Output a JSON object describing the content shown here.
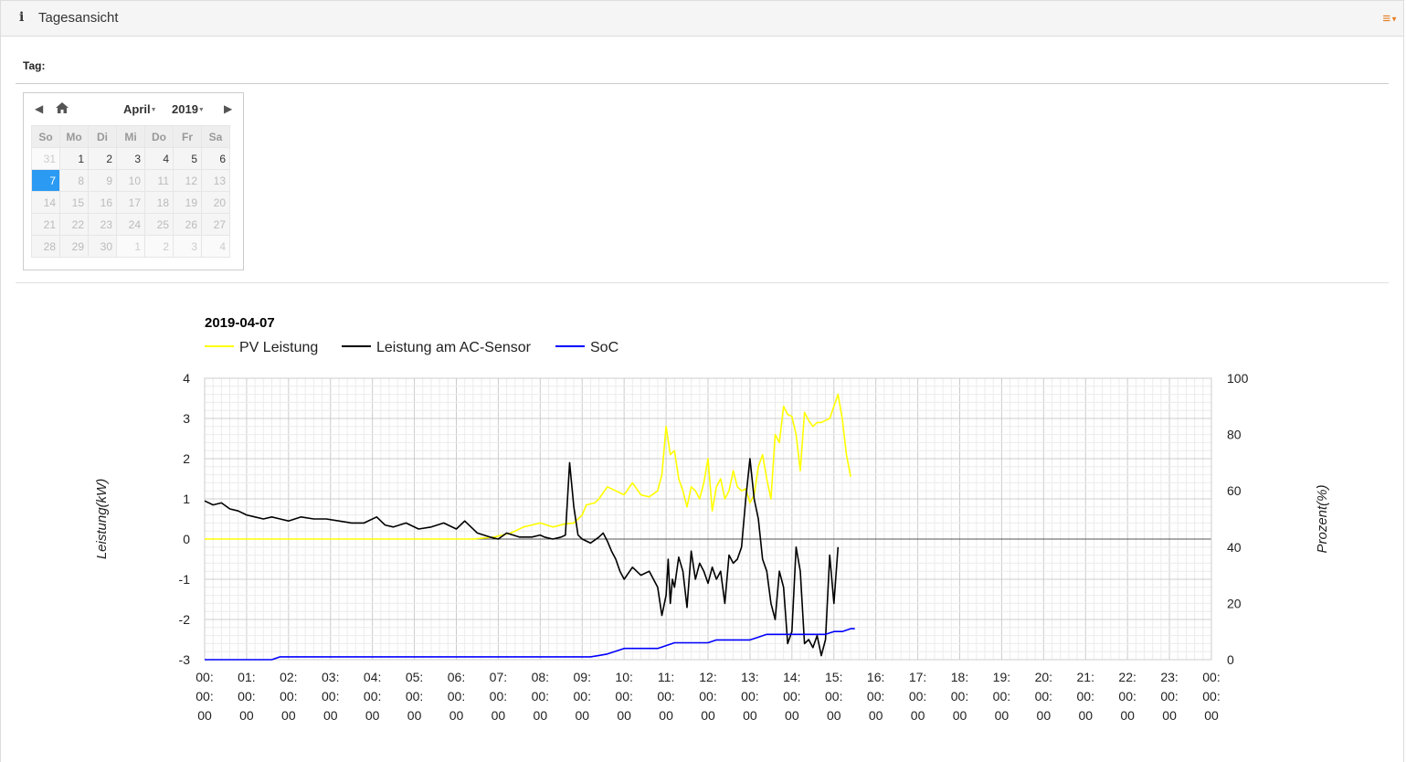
{
  "header": {
    "icon": "info-icon",
    "title": "Tagesansicht",
    "menu_icon": "menu-icon"
  },
  "form": {
    "tag_label": "Tag:"
  },
  "calendar": {
    "month": "April",
    "year": "2019",
    "weekdays": [
      "So",
      "Mo",
      "Di",
      "Mi",
      "Do",
      "Fr",
      "Sa"
    ],
    "weeks": [
      [
        "31",
        "1",
        "2",
        "3",
        "4",
        "5",
        "6"
      ],
      [
        "7",
        "8",
        "9",
        "10",
        "11",
        "12",
        "13"
      ],
      [
        "14",
        "15",
        "16",
        "17",
        "18",
        "19",
        "20"
      ],
      [
        "21",
        "22",
        "23",
        "24",
        "25",
        "26",
        "27"
      ],
      [
        "28",
        "29",
        "30",
        "1",
        "2",
        "3",
        "4"
      ]
    ],
    "selected": "7",
    "selected_color": "#2b9af3"
  },
  "chart_data": {
    "type": "line",
    "title": "2019-04-07",
    "ylabel_left": "Leistung(kW)",
    "ylabel_right": "Prozent(%)",
    "ylim_left": [
      -3,
      4
    ],
    "ylim_right": [
      0,
      100
    ],
    "yticks_left": [
      "4",
      "3",
      "2",
      "1",
      "0",
      "-1",
      "-2",
      "-3"
    ],
    "yticks_right": [
      "100",
      "80",
      "60",
      "40",
      "20",
      "0"
    ],
    "xlim_hours": [
      0,
      24
    ],
    "xticks": [
      "00:00:00",
      "01:00:00",
      "02:00:00",
      "03:00:00",
      "04:00:00",
      "05:00:00",
      "06:00:00",
      "07:00:00",
      "08:00:00",
      "09:00:00",
      "10:00:00",
      "11:00:00",
      "12:00:00",
      "13:00:00",
      "14:00:00",
      "15:00:00",
      "16:00:00",
      "17:00:00",
      "18:00:00",
      "19:00:00",
      "20:00:00",
      "21:00:00",
      "22:00:00",
      "23:00:00",
      "00:00:00"
    ],
    "legend_position": "top-left",
    "grid": true,
    "series": [
      {
        "name": "PV Leistung",
        "color": "#ffff00",
        "axis": "left",
        "x": [
          0,
          6.4,
          6.9,
          7.3,
          7.6,
          8.0,
          8.3,
          8.6,
          8.8,
          9.0,
          9.1,
          9.3,
          9.4,
          9.6,
          9.8,
          10.0,
          10.2,
          10.4,
          10.6,
          10.8,
          10.9,
          11.0,
          11.1,
          11.2,
          11.3,
          11.4,
          11.5,
          11.6,
          11.7,
          11.8,
          11.9,
          12.0,
          12.1,
          12.2,
          12.3,
          12.4,
          12.5,
          12.6,
          12.7,
          12.8,
          12.9,
          13.0,
          13.1,
          13.2,
          13.3,
          13.4,
          13.5,
          13.6,
          13.7,
          13.8,
          13.9,
          14.0,
          14.1,
          14.2,
          14.3,
          14.4,
          14.5,
          14.6,
          14.7,
          14.8,
          14.9,
          15.0,
          15.1,
          15.2,
          15.3,
          15.4,
          15.5
        ],
        "y": [
          0,
          0,
          0.05,
          0.15,
          0.3,
          0.4,
          0.3,
          0.38,
          0.4,
          0.6,
          0.85,
          0.9,
          1.0,
          1.3,
          1.2,
          1.1,
          1.4,
          1.1,
          1.05,
          1.2,
          1.6,
          2.8,
          2.1,
          2.2,
          1.5,
          1.2,
          0.8,
          1.3,
          1.2,
          1.0,
          1.4,
          2.0,
          0.7,
          1.3,
          1.5,
          1.0,
          1.2,
          1.7,
          1.3,
          1.2,
          1.25,
          0.9,
          1.1,
          1.8,
          2.1,
          1.5,
          1.0,
          2.6,
          2.4,
          3.3,
          3.1,
          3.05,
          2.6,
          1.7,
          3.15,
          2.95,
          2.8,
          2.9,
          2.9,
          2.95,
          3.0,
          3.3,
          3.6,
          3.0,
          2.1,
          1.55,
          null
        ]
      },
      {
        "name": "Leistung am AC-Sensor",
        "color": "#000000",
        "axis": "left",
        "x": [
          0,
          0.2,
          0.4,
          0.6,
          0.8,
          1.0,
          1.2,
          1.4,
          1.6,
          1.8,
          2.0,
          2.3,
          2.6,
          2.9,
          3.2,
          3.5,
          3.8,
          4.1,
          4.3,
          4.5,
          4.8,
          5.1,
          5.4,
          5.7,
          6.0,
          6.2,
          6.5,
          6.8,
          7.0,
          7.2,
          7.5,
          7.8,
          8.0,
          8.1,
          8.3,
          8.5,
          8.6,
          8.7,
          8.8,
          8.9,
          9.0,
          9.2,
          9.4,
          9.5,
          9.6,
          9.7,
          9.8,
          9.9,
          10.0,
          10.2,
          10.4,
          10.6,
          10.7,
          10.8,
          10.9,
          11.0,
          11.05,
          11.1,
          11.15,
          11.2,
          11.3,
          11.4,
          11.5,
          11.6,
          11.7,
          11.8,
          11.9,
          12.0,
          12.1,
          12.2,
          12.3,
          12.4,
          12.5,
          12.6,
          12.7,
          12.8,
          12.9,
          13.0,
          13.1,
          13.2,
          13.3,
          13.4,
          13.5,
          13.6,
          13.7,
          13.8,
          13.9,
          14.0,
          14.1,
          14.2,
          14.3,
          14.4,
          14.5,
          14.6,
          14.7,
          14.8,
          14.9,
          15.0,
          15.1,
          15.2,
          15.3,
          15.4,
          15.5
        ],
        "y": [
          0.95,
          0.85,
          0.9,
          0.75,
          0.7,
          0.6,
          0.55,
          0.5,
          0.55,
          0.5,
          0.45,
          0.55,
          0.5,
          0.5,
          0.45,
          0.4,
          0.4,
          0.55,
          0.35,
          0.3,
          0.4,
          0.25,
          0.3,
          0.4,
          0.25,
          0.45,
          0.15,
          0.05,
          0.0,
          0.15,
          0.05,
          0.05,
          0.1,
          0.05,
          0.0,
          0.05,
          0.1,
          1.9,
          0.8,
          0.1,
          0.0,
          -0.1,
          0.05,
          0.15,
          -0.05,
          -0.3,
          -0.5,
          -0.8,
          -1.0,
          -0.7,
          -0.9,
          -0.8,
          -1.0,
          -1.2,
          -1.9,
          -1.4,
          -0.5,
          -1.6,
          -1.0,
          -1.2,
          -0.45,
          -0.8,
          -1.7,
          -0.3,
          -1.0,
          -0.6,
          -0.8,
          -1.1,
          -0.7,
          -1.0,
          -0.8,
          -1.6,
          -0.4,
          -0.6,
          -0.5,
          -0.2,
          1.0,
          2.0,
          1.0,
          0.5,
          -0.5,
          -0.8,
          -1.6,
          -2.0,
          -0.8,
          -1.2,
          -2.6,
          -2.3,
          -0.2,
          -0.8,
          -2.6,
          -2.5,
          -2.7,
          -2.4,
          -2.9,
          -2.5,
          -0.4,
          -1.6,
          -0.2,
          null,
          null,
          null,
          null
        ]
      },
      {
        "name": "SoC",
        "color": "#0000ff",
        "axis": "right",
        "x": [
          0,
          1.6,
          1.8,
          2.0,
          4.0,
          6.0,
          8.0,
          9.0,
          9.2,
          9.4,
          9.6,
          9.8,
          10.0,
          10.4,
          10.8,
          11.0,
          11.2,
          11.4,
          12.0,
          12.2,
          12.4,
          13.0,
          13.2,
          13.4,
          14.0,
          14.4,
          14.8,
          15.0,
          15.2,
          15.4,
          15.5
        ],
        "y": [
          0,
          0,
          1,
          1,
          1,
          1,
          1,
          1,
          1,
          1.5,
          2,
          3,
          4,
          4,
          4,
          5,
          6,
          6,
          6,
          7,
          7,
          7,
          8,
          9,
          9,
          9,
          9,
          10,
          10,
          11,
          11
        ]
      }
    ]
  }
}
